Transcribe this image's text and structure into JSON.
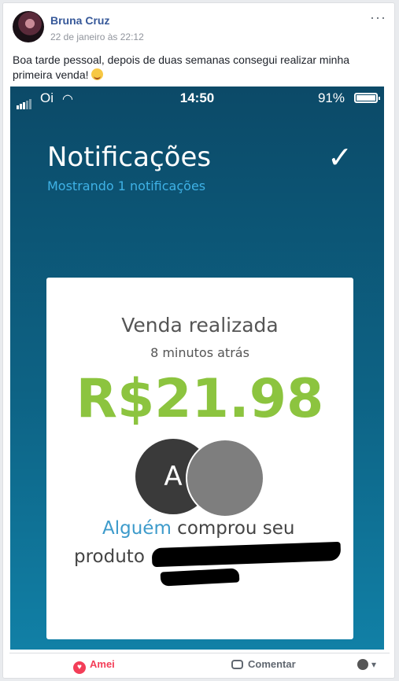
{
  "post": {
    "author": "Bruna Cruz",
    "timestamp": "22 de janeiro às 22:12",
    "text": "Boa tarde pessoal, depois de duas semanas consegui realizar minha primeira venda!",
    "more_label": "···"
  },
  "phone": {
    "carrier": "Oi",
    "time": "14:50",
    "battery": "91%",
    "header": {
      "title": "Notificações",
      "subtitle": "Mostrando 1 notificações",
      "check": "✓"
    },
    "card": {
      "title": "Venda realizada",
      "time_ago": "8 minutos atrás",
      "amount": "R$21.98",
      "avatar_initial": "A",
      "buyer": "Alguém",
      "message": " comprou seu",
      "product_label": "produto"
    }
  },
  "actions": {
    "react_label": "Amei",
    "comment_label": "Comentar"
  }
}
